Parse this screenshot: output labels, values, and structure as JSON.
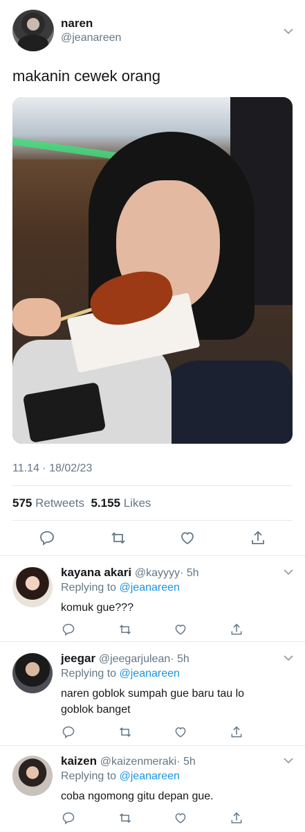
{
  "tweet": {
    "author_name": "naren",
    "author_handle": "@jeanareen",
    "text": "makanin cewek orang",
    "photo_icon": "photo-of-girl-eating-chicken-skewer",
    "timestamp": "11.14 · 18/02/23",
    "retweets_count": "575",
    "retweets_label": "Retweets",
    "likes_count": "5.155",
    "likes_label": "Likes"
  },
  "actions": [
    "reply-icon",
    "retweet-icon",
    "like-icon",
    "share-icon"
  ],
  "replies": [
    {
      "name": "kayana akari",
      "handle": "@kayyyy",
      "time": "· 5h",
      "replying_prefix": "Replying to",
      "replying_to": "@jeanareen",
      "text": "komuk gue???"
    },
    {
      "name": "jeegar",
      "handle": "@jeegarjulean",
      "time": "· 5h",
      "replying_prefix": "Replying to",
      "replying_to": "@jeanareen",
      "text": "naren goblok sumpah gue baru tau lo goblok banget"
    },
    {
      "name": "kaizen",
      "handle": "@kaizenmeraki",
      "time": "· 5h",
      "replying_prefix": "Replying to",
      "replying_to": "@jeanareen",
      "text": "coba ngomong gitu depan gue."
    }
  ],
  "colors": {
    "text": "#14171a",
    "secondary": "#657786",
    "link": "#1b95e0",
    "divider": "#e1e8ed"
  }
}
